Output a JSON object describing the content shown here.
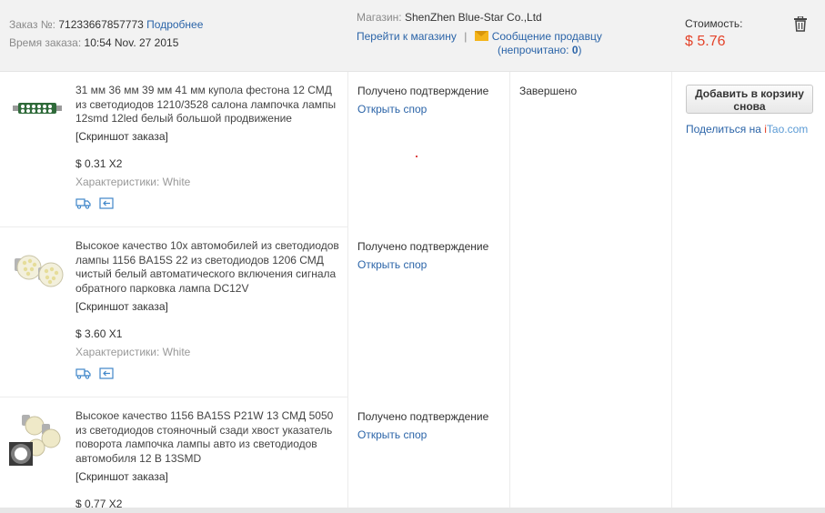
{
  "header": {
    "order_label": "Заказ №:",
    "order_number": "71233667857773",
    "details_link": "Подробнее",
    "time_label": "Время заказа:",
    "time_value": "10:54 Nov. 27 2015",
    "store_label": "Магазин:",
    "store_name": "ShenZhen Blue-Star Co.,Ltd",
    "go_to_store": "Перейти к магазину",
    "separator": "|",
    "message_seller": "Сообщение продавцу",
    "unread_prefix": "(непрочитано: ",
    "unread_count": "0",
    "unread_suffix": ")",
    "cost_label": "Стоимость:",
    "cost_value": "$ 5.76"
  },
  "items": [
    {
      "title": "31 мм 36 мм 39 мм 41 мм купола фестона 12 СМД из светодиодов 1210/3528 салона лампочка лампы 12smd 12led белый большой продвижение",
      "snapshot": "[Скриншот заказа]",
      "price": "$ 0.31 X2",
      "props_label": "Характеристики:",
      "props_value": "White",
      "status": "Получено подтверждение",
      "dispute": "Открыть спор"
    },
    {
      "title": "Высокое качество 10x автомобилей из светодиодов лампы 1156 BA15S 22 из светодиодов 1206 СМД чистый белый автоматического включения сигнала обратного парковка лампа DC12V",
      "snapshot": "[Скриншот заказа]",
      "price": "$ 3.60 X1",
      "props_label": "Характеристики:",
      "props_value": "White",
      "status": "Получено подтверждение",
      "dispute": "Открыть спор"
    },
    {
      "title": "Высокое качество 1156 BA15S P21W 13 СМД 5050 из светодиодов стояночный сзади хвост указатель поворота лампочка лампы авто из светодиодов автомобиля 12 В 13SMD",
      "snapshot": "[Скриншот заказа]",
      "price": "$ 0.77 X2",
      "status": "Получено подтверждение",
      "dispute": "Открыть спор"
    }
  ],
  "order_status": "Завершено",
  "actions": {
    "add_to_cart": "Добавить в корзину снова",
    "share_prefix": "Поделиться на ",
    "share_i": "i",
    "share_rest": "Tao.com"
  },
  "icons": {
    "delete": "trash-icon",
    "message": "envelope-icon",
    "shipping": "truck-icon",
    "return": "return-icon"
  },
  "colors": {
    "price_accent": "#e4432a",
    "link": "#2b64a8",
    "header_bg": "#f2f2f2"
  }
}
